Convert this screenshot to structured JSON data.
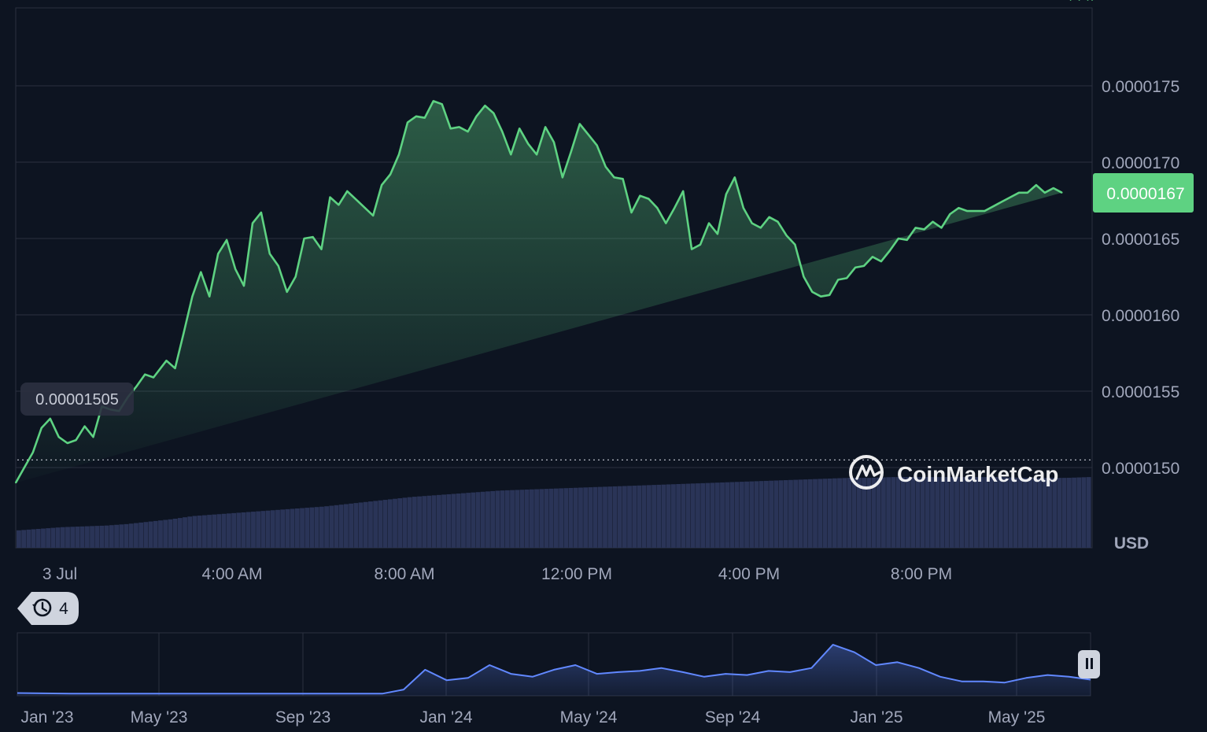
{
  "chart_data": [
    {
      "type": "area",
      "title": "",
      "xlabel": "",
      "ylabel": "USD",
      "x_ticks": [
        "3 Jul",
        "4:00 AM",
        "8:00 AM",
        "12:00 PM",
        "4:00 PM",
        "8:00 PM"
      ],
      "y_ticks": [
        "0.0000150",
        "0.0000155",
        "0.0000160",
        "0.0000165",
        "0.0000170",
        "0.0000175"
      ],
      "ylim": [
        1.475e-05,
        1.8e-05
      ],
      "xlim": [
        0,
        25
      ],
      "grid": true,
      "current_price_label": "0.0000167",
      "open_price_label": "0.00001505",
      "open_price": 1.505e-05,
      "x": [
        0,
        0.2,
        0.4,
        0.6,
        0.8,
        1.0,
        1.2,
        1.4,
        1.6,
        1.8,
        2.0,
        2.2,
        2.4,
        2.6,
        2.8,
        3.0,
        3.2,
        3.5,
        3.7,
        3.9,
        4.1,
        4.3,
        4.5,
        4.7,
        4.9,
        5.1,
        5.3,
        5.5,
        5.7,
        5.9,
        6.1,
        6.3,
        6.5,
        6.7,
        6.9,
        7.1,
        7.3,
        7.5,
        7.7,
        8.0,
        8.3,
        8.5,
        8.7,
        8.9,
        9.1,
        9.3,
        9.5,
        9.7,
        9.9,
        10.1,
        10.3,
        10.5,
        10.7,
        10.9,
        11.1,
        11.3,
        11.5,
        11.7,
        11.9,
        12.1,
        12.3,
        12.5,
        12.7,
        12.9,
        13.1,
        13.3,
        13.5,
        13.7,
        13.9,
        14.1,
        14.3,
        14.5,
        14.7,
        14.9,
        15.1,
        15.3,
        15.5,
        15.7,
        15.9,
        16.1,
        16.3,
        16.5,
        16.7,
        16.9,
        17.1,
        17.3,
        17.5,
        17.7,
        17.9,
        18.1,
        18.3,
        18.5,
        18.7,
        18.9,
        19.1,
        19.3,
        19.5,
        19.7,
        19.9,
        20.1,
        20.3,
        20.5,
        20.7,
        20.9,
        21.1,
        21.3,
        21.5,
        21.7,
        21.9,
        22.1,
        22.3,
        22.5,
        22.7,
        22.9,
        23.1,
        23.3,
        23.5,
        23.7,
        23.9,
        24.1,
        24.3,
        24.5,
        24.7,
        24.9,
        25.0
      ],
      "series": [
        {
          "name": "",
          "color": "#5ed282",
          "values": [
            1.49e-05,
            1.5e-05,
            1.51e-05,
            1.526e-05,
            1.532e-05,
            1.52e-05,
            1.516e-05,
            1.518e-05,
            1.527e-05,
            1.52e-05,
            1.54e-05,
            1.538e-05,
            1.537e-05,
            1.546e-05,
            1.553e-05,
            1.561e-05,
            1.559e-05,
            1.57e-05,
            1.565e-05,
            1.588e-05,
            1.612e-05,
            1.628e-05,
            1.612e-05,
            1.64e-05,
            1.649e-05,
            1.63e-05,
            1.619e-05,
            1.66e-05,
            1.667e-05,
            1.64e-05,
            1.632e-05,
            1.615e-05,
            1.625e-05,
            1.65e-05,
            1.651e-05,
            1.643e-05,
            1.677e-05,
            1.672e-05,
            1.681e-05,
            1.673e-05,
            1.665e-05,
            1.685e-05,
            1.692e-05,
            1.705e-05,
            1.726e-05,
            1.73e-05,
            1.729e-05,
            1.74e-05,
            1.738e-05,
            1.722e-05,
            1.723e-05,
            1.72e-05,
            1.73e-05,
            1.737e-05,
            1.732e-05,
            1.72e-05,
            1.705e-05,
            1.722e-05,
            1.712e-05,
            1.705e-05,
            1.723e-05,
            1.713e-05,
            1.69e-05,
            1.707e-05,
            1.725e-05,
            1.718e-05,
            1.711e-05,
            1.697e-05,
            1.69e-05,
            1.689e-05,
            1.667e-05,
            1.678e-05,
            1.676e-05,
            1.67e-05,
            1.66e-05,
            1.67e-05,
            1.681e-05,
            1.643e-05,
            1.646e-05,
            1.66e-05,
            1.653e-05,
            1.679e-05,
            1.69e-05,
            1.67e-05,
            1.66e-05,
            1.657e-05,
            1.664e-05,
            1.661e-05,
            1.652e-05,
            1.646e-05,
            1.625e-05,
            1.615e-05,
            1.612e-05,
            1.613e-05,
            1.623e-05,
            1.624e-05,
            1.631e-05,
            1.632e-05,
            1.638e-05,
            1.635e-05,
            1.642e-05,
            1.65e-05,
            1.649e-05,
            1.657e-05,
            1.656e-05,
            1.661e-05,
            1.657e-05,
            1.666e-05,
            1.67e-05,
            1.668e-05,
            1.668e-05,
            1.668e-05,
            1.671e-05,
            1.674e-05,
            1.677e-05,
            1.68e-05,
            1.68e-05,
            1.685e-05,
            1.68e-05,
            1.683e-05,
            1.68e-05
          ]
        }
      ],
      "volume": {
        "color": "#2a3457",
        "values": [
          0.22,
          0.24,
          0.26,
          0.27,
          0.28,
          0.3,
          0.33,
          0.36,
          0.4,
          0.42,
          0.44,
          0.46,
          0.48,
          0.5,
          0.52,
          0.55,
          0.58,
          0.61,
          0.64,
          0.66,
          0.68,
          0.7,
          0.72,
          0.73,
          0.74,
          0.75,
          0.76,
          0.77,
          0.78,
          0.79,
          0.8,
          0.81,
          0.82,
          0.83,
          0.84,
          0.85,
          0.86,
          0.87,
          0.88,
          0.88,
          0.89,
          0.89,
          0.89,
          0.89,
          0.89,
          0.89,
          0.88,
          0.88,
          0.88,
          0.89
        ]
      }
    },
    {
      "type": "area",
      "title": "",
      "xlabel": "",
      "ylabel": "",
      "x_ticks": [
        "Jan '23",
        "May '23",
        "Sep '23",
        "Jan '24",
        "May '24",
        "Sep '24",
        "Jan '25",
        "May '25"
      ],
      "x": [
        0,
        5,
        10,
        15,
        20,
        22,
        24,
        26,
        28,
        30,
        31,
        32,
        33,
        34,
        36,
        38,
        40,
        42,
        44,
        46,
        48,
        50,
        52,
        54,
        56,
        58,
        60,
        62,
        64,
        66,
        68,
        70,
        72,
        74,
        76,
        78,
        80,
        82,
        84,
        86,
        88,
        90,
        92,
        94,
        96,
        98,
        100
      ],
      "series": [
        {
          "name": "",
          "color": "#6188ff",
          "values": [
            0.02,
            0.01,
            0.01,
            0.01,
            0.01,
            0.01,
            0.01,
            0.01,
            0.01,
            0.01,
            0.01,
            0.01,
            0.01,
            0.01,
            0.08,
            0.42,
            0.24,
            0.28,
            0.5,
            0.35,
            0.3,
            0.42,
            0.5,
            0.35,
            0.38,
            0.4,
            0.45,
            0.38,
            0.3,
            0.35,
            0.33,
            0.4,
            0.38,
            0.45,
            0.85,
            0.72,
            0.5,
            0.55,
            0.45,
            0.3,
            0.22,
            0.22,
            0.2,
            0.28,
            0.33,
            0.3,
            0.25
          ]
        }
      ],
      "range_badge": "4"
    }
  ],
  "brand": {
    "name": "CoinMarketCap"
  },
  "colors": {
    "background": "#0d1421",
    "line": "#5ed282",
    "price_tag_bg": "#5ed282",
    "grid": "#2a3040",
    "axis_text": "#a1a7bb"
  },
  "icons": {
    "history": "history-icon",
    "pause": "pause-icon",
    "logo": "coinmarketcap-logo-icon"
  }
}
